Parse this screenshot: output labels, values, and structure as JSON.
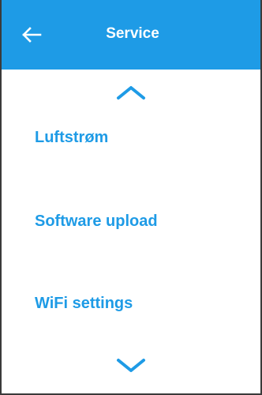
{
  "header": {
    "title": "Service",
    "back_icon": "arrow-left-icon",
    "background_color": "#1e9be6"
  },
  "navigation": {
    "scroll_up_icon": "chevron-up-icon",
    "scroll_down_icon": "chevron-down-icon"
  },
  "menu": {
    "items": [
      {
        "label": "Luftstrøm"
      },
      {
        "label": "Software upload"
      },
      {
        "label": "WiFi settings"
      }
    ],
    "text_color": "#1e9be6"
  }
}
